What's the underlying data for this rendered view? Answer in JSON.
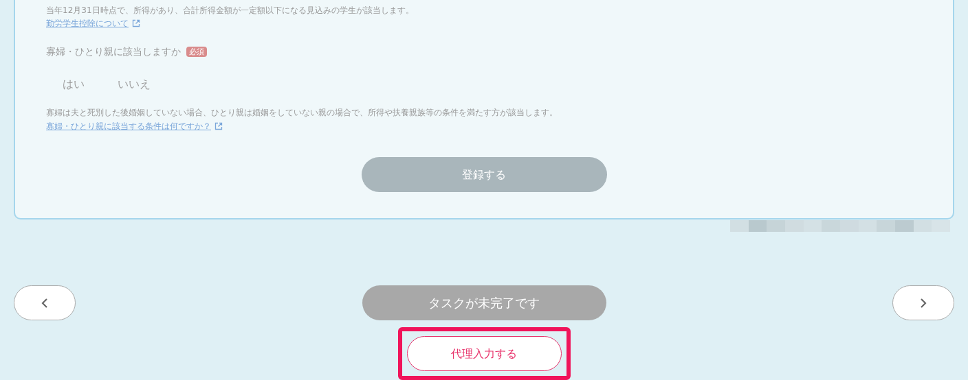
{
  "form": {
    "student_note": "当年12月31日時点で、所得があり、合計所得金額が一定額以下になる見込みの学生が該当します。",
    "student_link": "勤労学生控除について",
    "question": {
      "label": "寡婦・ひとり親に該当しますか",
      "badge": "必須"
    },
    "options": [
      {
        "label": "はい",
        "selected": false
      },
      {
        "label": "いいえ",
        "selected": false
      }
    ],
    "note": "寡婦は夫と死別した後婚姻していない場合、ひとり親は婚姻をしていない親の場合で、所得や扶養親族等の条件を満たす方が該当します。",
    "link": "寡婦・ひとり親に該当する条件は何ですか？",
    "submit": {
      "label": "登録する",
      "disabled": true
    }
  },
  "nav": {
    "status_button": {
      "label": "タスクが未完了です",
      "disabled": true
    },
    "proxy_button": {
      "label": "代理入力する",
      "highlighted": true
    }
  }
}
